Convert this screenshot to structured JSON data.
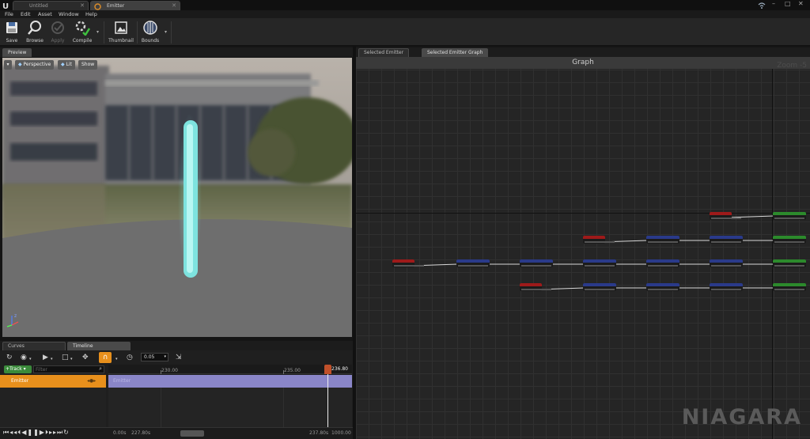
{
  "titlebar": {
    "tabs": [
      {
        "label": "Untitled",
        "active": false
      },
      {
        "label": "Emitter",
        "active": true
      }
    ]
  },
  "menu": [
    "File",
    "Edit",
    "Asset",
    "Window",
    "Help"
  ],
  "toolbar": {
    "save": "Save",
    "browse": "Browse",
    "apply": "Apply",
    "compile": "Compile",
    "thumbnail": "Thumbnail",
    "bounds": "Bounds"
  },
  "preview": {
    "tab": "Preview",
    "perspective": "Perspective",
    "lit": "Lit",
    "show": "Show"
  },
  "right_tabs": [
    "Selected Emitter",
    "Selected Emitter Graph"
  ],
  "graph": {
    "title": "Graph",
    "zoom": "Zoom -5"
  },
  "sequencer": {
    "tabs": [
      "Curves",
      "Timeline"
    ],
    "step": "0.05",
    "track_button": "Track",
    "filter_placeholder": "Filter",
    "track_row": "Emitter",
    "ruler": [
      "230.00",
      "235.00"
    ],
    "playhead_time": "236.80",
    "bar_label": "Emitter",
    "footer_left": [
      "0.00s",
      "227.80s"
    ],
    "footer_right": [
      "237.80s",
      "1000.00"
    ]
  },
  "brand": "NIAGARA",
  "colors": {
    "accent_orange": "#e8901c",
    "track_purple": "#8a86c8",
    "node_red": "#9e1a1a",
    "node_blue": "#2a3a8a",
    "node_green": "#2c8a2c",
    "beam_cyan": "#7ee3df"
  }
}
